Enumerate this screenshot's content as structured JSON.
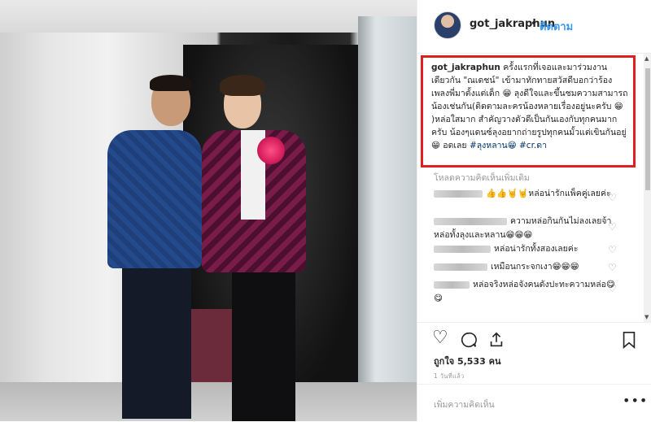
{
  "header": {
    "username": "got_jakraphun",
    "separator": "•",
    "follow_label": "ติดตาม"
  },
  "caption": {
    "username": "got_jakraphun",
    "text": "ครั้งแรกที่เจอและมาร่วมงานเดียวกัน \"ณเดชน์\" เข้ามาทักทายสวัสดีบอกว่าร้องเพลงพี่มาตั้งแต่เด็ก 😁 ลุงดีใจและขึ้นชมความสามารถน้องเช่นกัน(ติดตามละครน้องหลายเรื่องอยู่นะครับ 😁 )หล่อใสมาก สำคัญวางตัวดีเป็นกันเองกับทุกคนมากครับ น้องๆแดนซ์ลุงอยากถ่ายรูปทุกคนมั้วแต่เขินกันอยู่ 😁 อดเลย",
    "tags": "#ลุงหลาน😁 #cr.ดา"
  },
  "load_more_label": "โหลดความคิดเห็นเพิ่มเติม",
  "comments": [
    {
      "text": "👍👍🤘🤘หล่อน่ารักแพ็คคู่เลยค่ะ"
    },
    {
      "text": "ความหล่อกินกันไม่ลงเลยจ้า หล่อทั้งลุงและหลาน😁😁😁"
    },
    {
      "text": "หล่อน่ารักทั้งสองเลยค่ะ"
    },
    {
      "text": "เหมือนกระจกเงา😁😁😁"
    },
    {
      "text": "หล่อจริงหล่อจังคนดังปะทะความหล่อ😋😋"
    }
  ],
  "icons": {
    "like": "heart-icon",
    "comment": "comment-icon",
    "share": "share-icon",
    "save": "bookmark-icon",
    "more": "more-icon"
  },
  "likes_label": "ถูกใจ 5,533 คน",
  "timestamp": "1 วันที่แล้ว",
  "add_comment_placeholder": "เพิ่มความคิดเห็น",
  "more_symbol": "•••",
  "colors": {
    "link_blue": "#3897f0",
    "highlight_red": "#e02020",
    "hashtag_blue": "#003569",
    "muted_gray": "#999999"
  }
}
